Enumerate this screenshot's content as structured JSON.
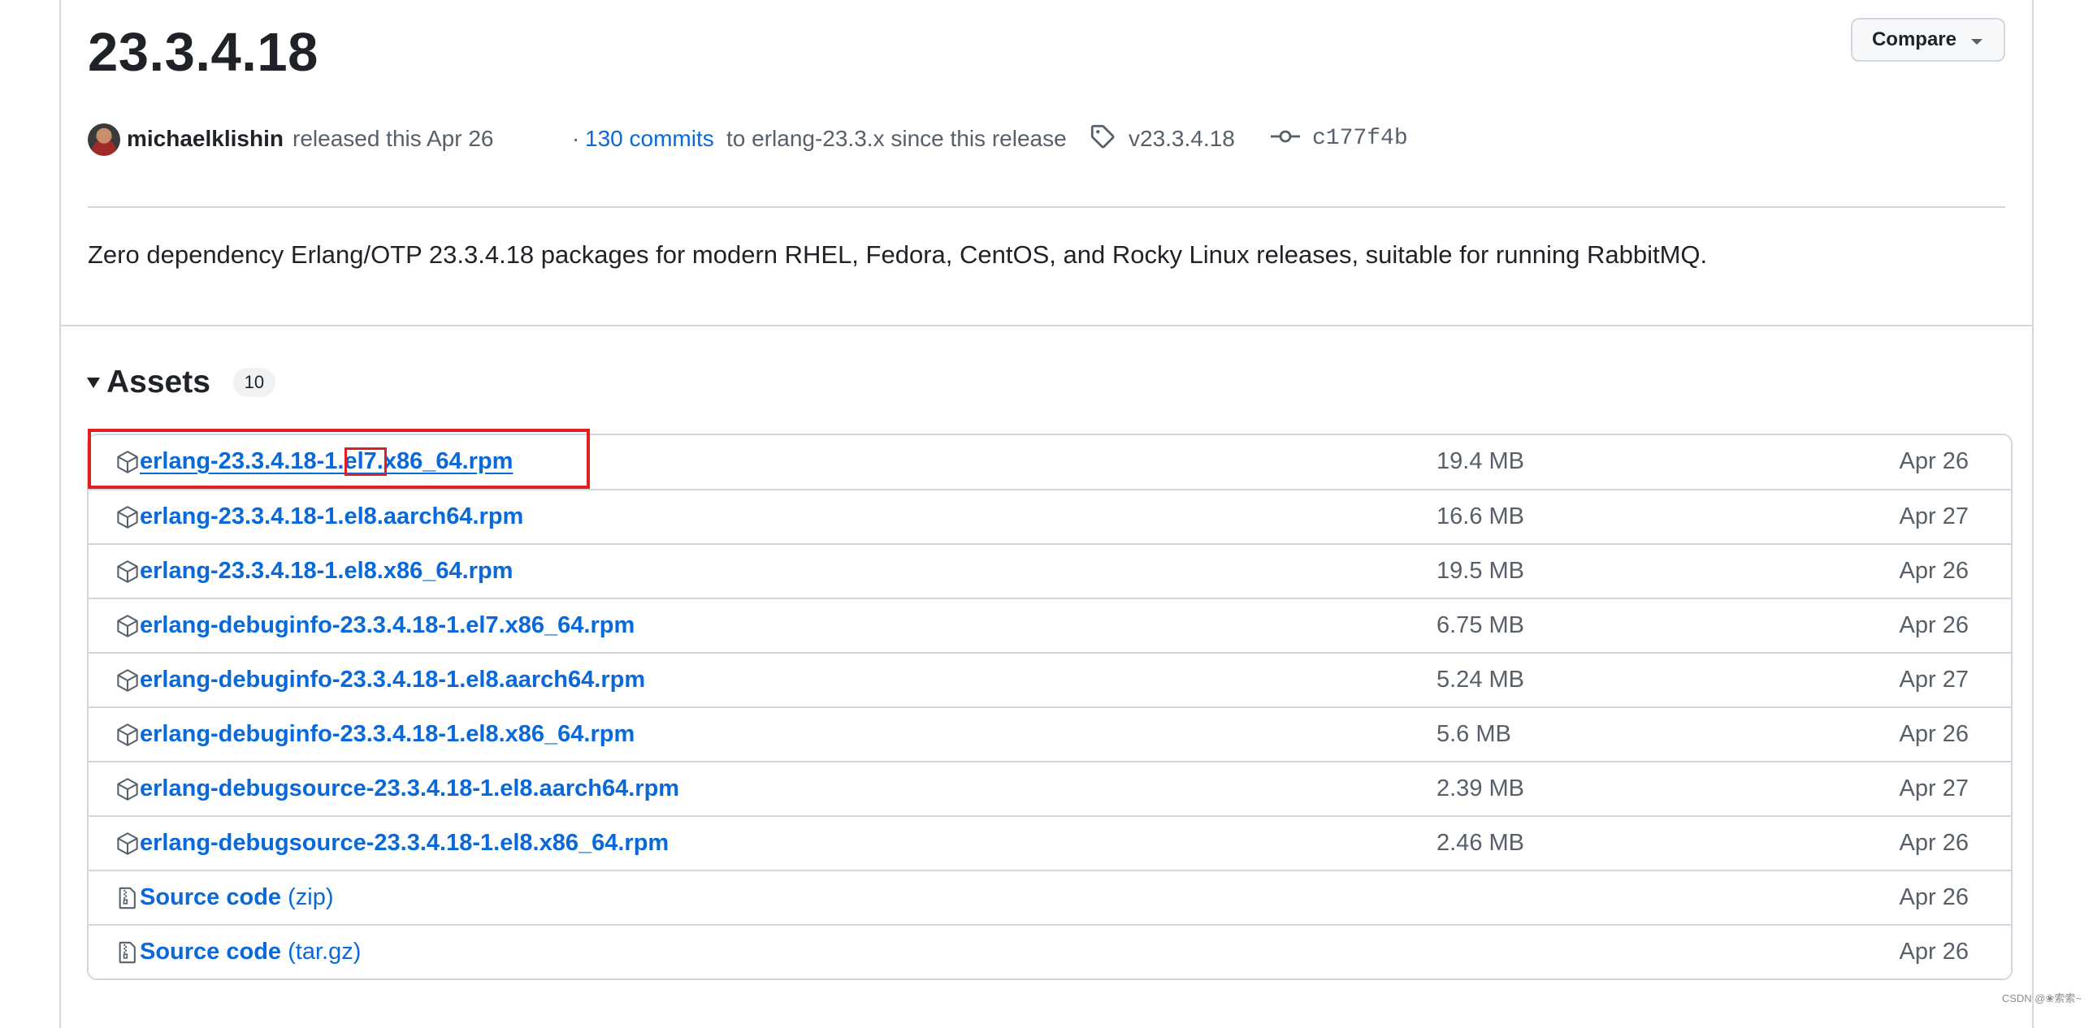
{
  "release": {
    "title": "23.3.4.18",
    "compare_label": "Compare",
    "author": "michaelklishin",
    "released_text": "released this Apr 26",
    "commits_prefix": "·",
    "commits_link": "130 commits",
    "commits_suffix": "to erlang-23.3.x since this release",
    "tag": "v23.3.4.18",
    "commit": "c177f4b",
    "description": "Zero dependency Erlang/OTP 23.3.4.18 packages for modern RHEL, Fedora, CentOS, and Rocky Linux releases, suitable for running RabbitMQ."
  },
  "assets": {
    "heading": "Assets",
    "count": "10",
    "rows": [
      {
        "name": "erlang-23.3.4.18-1.el7.x86_64.rpm",
        "ext": "",
        "size": "19.4 MB",
        "date": "Apr 26",
        "icon": "package-icon"
      },
      {
        "name": "erlang-23.3.4.18-1.el8.aarch64.rpm",
        "ext": "",
        "size": "16.6 MB",
        "date": "Apr 27",
        "icon": "package-icon"
      },
      {
        "name": "erlang-23.3.4.18-1.el8.x86_64.rpm",
        "ext": "",
        "size": "19.5 MB",
        "date": "Apr 26",
        "icon": "package-icon"
      },
      {
        "name": "erlang-debuginfo-23.3.4.18-1.el7.x86_64.rpm",
        "ext": "",
        "size": "6.75 MB",
        "date": "Apr 26",
        "icon": "package-icon"
      },
      {
        "name": "erlang-debuginfo-23.3.4.18-1.el8.aarch64.rpm",
        "ext": "",
        "size": "5.24 MB",
        "date": "Apr 27",
        "icon": "package-icon"
      },
      {
        "name": "erlang-debuginfo-23.3.4.18-1.el8.x86_64.rpm",
        "ext": "",
        "size": "5.6 MB",
        "date": "Apr 26",
        "icon": "package-icon"
      },
      {
        "name": "erlang-debugsource-23.3.4.18-1.el8.aarch64.rpm",
        "ext": "",
        "size": "2.39 MB",
        "date": "Apr 27",
        "icon": "package-icon"
      },
      {
        "name": "erlang-debugsource-23.3.4.18-1.el8.x86_64.rpm",
        "ext": "",
        "size": "2.46 MB",
        "date": "Apr 26",
        "icon": "package-icon"
      },
      {
        "name": "Source code",
        "ext": "(zip)",
        "size": "",
        "date": "Apr 26",
        "icon": "file-zip-icon"
      },
      {
        "name": "Source code",
        "ext": "(tar.gz)",
        "size": "",
        "date": "Apr 26",
        "icon": "file-zip-icon"
      }
    ]
  },
  "watermark": "CSDN @❀索索~",
  "colors": {
    "link": "#0969da",
    "muted": "#57606a",
    "border": "#d0d7de",
    "highlight": "#e02020"
  }
}
